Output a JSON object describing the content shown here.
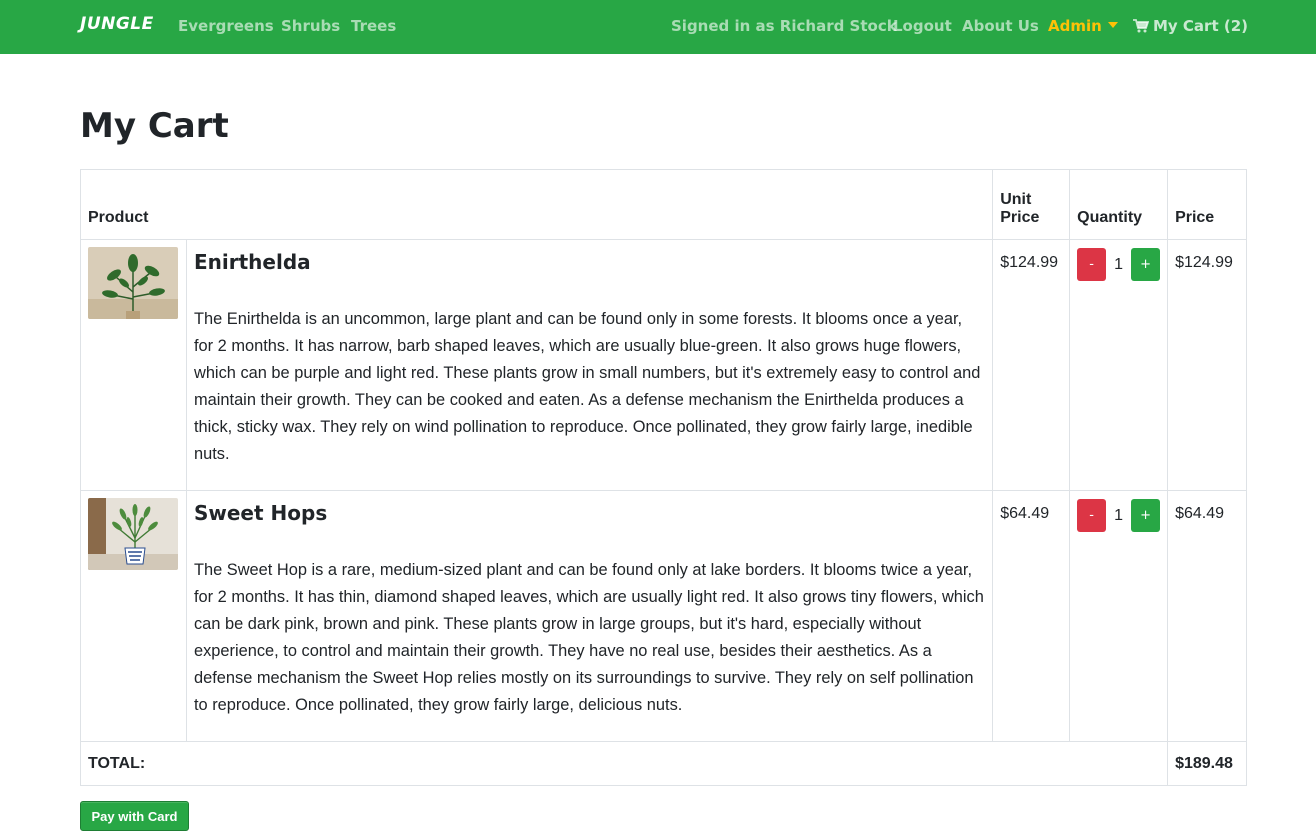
{
  "nav": {
    "brand": "JUNGLE",
    "links": [
      "Evergreens",
      "Shrubs",
      "Trees"
    ],
    "signed_in": "Signed in as Richard Stock",
    "logout": "Logout",
    "about": "About Us",
    "admin": "Admin",
    "cart": "My Cart (2)"
  },
  "page": {
    "title": "My Cart"
  },
  "table": {
    "headers": {
      "product": "Product",
      "unit_price": "Unit Price",
      "quantity": "Quantity",
      "price": "Price"
    },
    "items": [
      {
        "name": "Enirthelda",
        "description": "The Enirthelda is an uncommon, large plant and can be found only in some forests. It blooms once a year, for 2 months. It has narrow, barb shaped leaves, which are usually blue-green. It also grows huge flowers, which can be purple and light red. These plants grow in small numbers, but it's extremely easy to control and maintain their growth. They can be cooked and eaten. As a defense mechanism the Enirthelda produces a thick, sticky wax. They rely on wind pollination to reproduce. Once pollinated, they grow fairly large, inedible nuts.",
        "unit_price": "$124.99",
        "quantity": "1",
        "price": "$124.99",
        "minus": "-",
        "plus": "+"
      },
      {
        "name": "Sweet Hops",
        "description": "The Sweet Hop is a rare, medium-sized plant and can be found only at lake borders. It blooms twice a year, for 2 months. It has thin, diamond shaped leaves, which are usually light red. It also grows tiny flowers, which can be dark pink, brown and pink. These plants grow in large groups, but it's hard, especially without experience, to control and maintain their growth. They have no real use, besides their aesthetics. As a defense mechanism the Sweet Hop relies mostly on its surroundings to survive. They rely on self pollination to reproduce. Once pollinated, they grow fairly large, delicious nuts.",
        "unit_price": "$64.49",
        "quantity": "1",
        "price": "$64.49",
        "minus": "-",
        "plus": "+"
      }
    ],
    "total_label": "TOTAL:",
    "total_value": "$189.48"
  },
  "pay_button": "Pay with Card",
  "colors": {
    "navbar": "#28a745",
    "admin": "#ffc107",
    "minus": "#dc3545",
    "plus": "#28a745"
  },
  "icons": {
    "cart": "shopping-cart-icon"
  }
}
